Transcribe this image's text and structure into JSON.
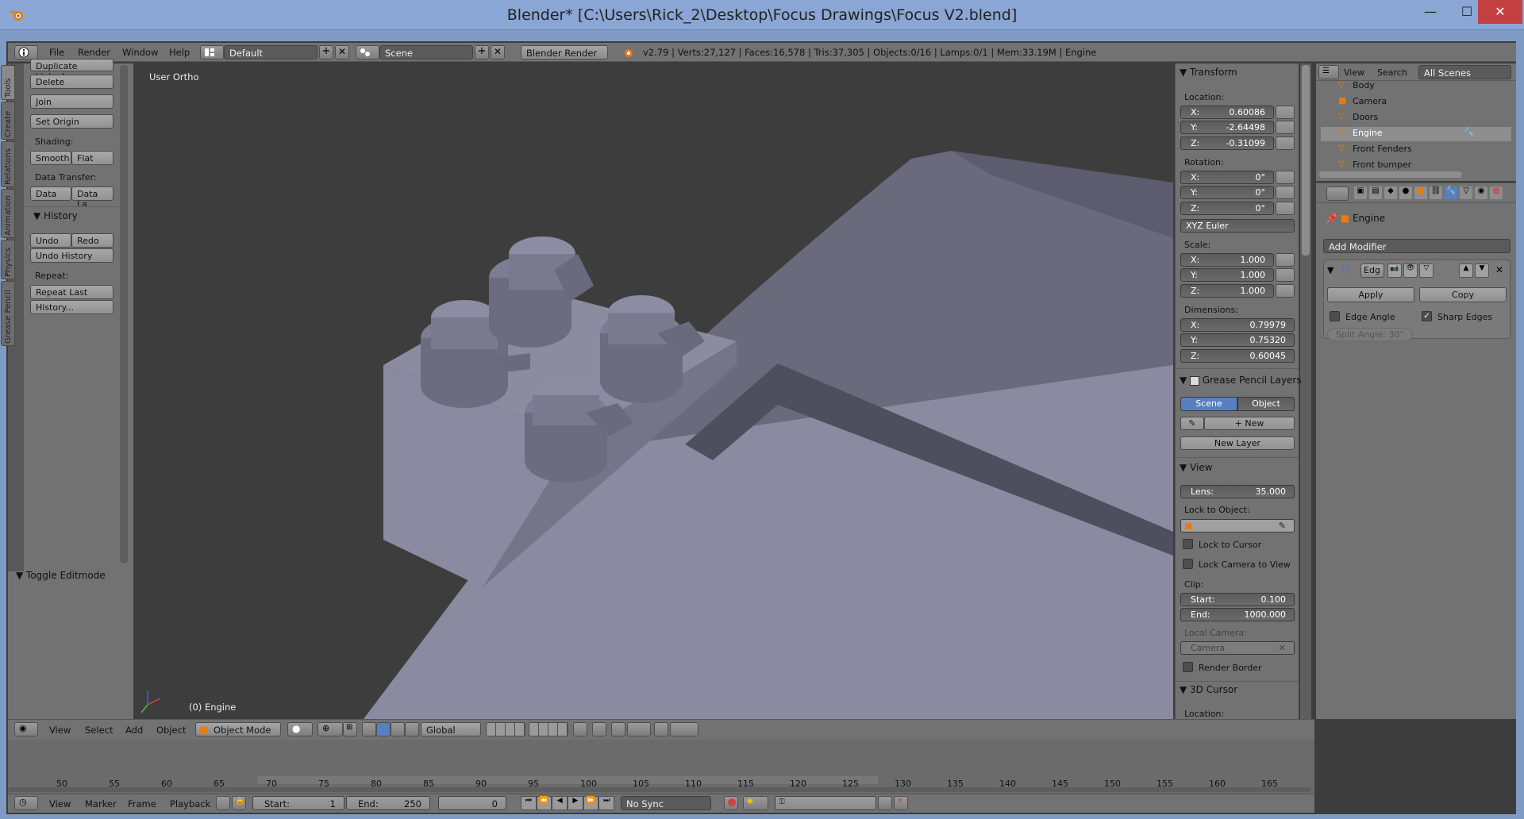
{
  "window": {
    "title": "Blender* [C:\\Users\\Rick_2\\Desktop\\Focus Drawings\\Focus V2.blend]",
    "minimize": "—",
    "maximize": "☐",
    "close": "✕"
  },
  "info_header": {
    "menus": [
      "File",
      "Render",
      "Window",
      "Help"
    ],
    "layout": "Default",
    "scene": "Scene",
    "engine": "Blender Render",
    "stats": "v2.79 | Verts:27,127 | Faces:16,578 | Tris:37,305 | Objects:0/16 | Lamps:0/1 | Mem:33.19M | Engine"
  },
  "tool_tabs": [
    "Tools",
    "Create",
    "Relations",
    "Animation",
    "Physics",
    "Grease Pencil"
  ],
  "tool_shelf": {
    "duplicate_linked": "Duplicate Linked",
    "delete": "Delete",
    "join": "Join",
    "set_origin": "Set Origin",
    "shading_label": "Shading:",
    "smooth": "Smooth",
    "flat": "Flat",
    "data_transfer_label": "Data Transfer:",
    "data": "Data",
    "data_layout": "Data La",
    "history_title": "History",
    "undo": "Undo",
    "redo": "Redo",
    "undo_history": "Undo History",
    "repeat_label": "Repeat:",
    "repeat_last": "Repeat Last",
    "history_btn": "History...",
    "toggle_editmode": "Toggle Editmode"
  },
  "viewport": {
    "view_label": "User Ortho",
    "object_label": "(0) Engine"
  },
  "npanel": {
    "transform_title": "Transform",
    "location_label": "Location:",
    "location": {
      "x": "0.60086",
      "y": "-2.64498",
      "z": "-0.31099"
    },
    "rotation_label": "Rotation:",
    "rotation": {
      "x": "0°",
      "y": "0°",
      "z": "0°"
    },
    "rotation_mode": "XYZ Euler",
    "scale_label": "Scale:",
    "scale": {
      "x": "1.000",
      "y": "1.000",
      "z": "1.000"
    },
    "dimensions_label": "Dimensions:",
    "dimensions": {
      "x": "0.79979",
      "y": "0.75320",
      "z": "0.60045"
    },
    "axis_x": "X:",
    "axis_y": "Y:",
    "axis_z": "Z:",
    "gp_title": "Grease Pencil Layers",
    "gp_scene": "Scene",
    "gp_object": "Object",
    "gp_new": "New",
    "gp_new_layer": "New Layer",
    "view_title": "View",
    "lens_label": "Lens:",
    "lens": "35.000",
    "lock_to_object": "Lock to Object:",
    "lock_to_cursor": "Lock to Cursor",
    "lock_camera": "Lock Camera to View",
    "clip_label": "Clip:",
    "clip_start_label": "Start:",
    "clip_start": "0.100",
    "clip_end_label": "End:",
    "clip_end": "1000.000",
    "local_camera": "Local Camera:",
    "camera": "Camera",
    "render_border": "Render Border",
    "cursor_title": "3D Cursor",
    "cursor_location": "Location:"
  },
  "outliner": {
    "view": "View",
    "search": "Search",
    "filter": "All Scenes",
    "items": [
      "Body",
      "Camera",
      "Doors",
      "Engine",
      "Front Fenders",
      "Front bumper"
    ],
    "selected_index": 3
  },
  "properties": {
    "object_name": "Engine",
    "add_modifier": "Add Modifier",
    "modifier_name": "Edg",
    "apply": "Apply",
    "copy": "Copy",
    "edge_angle": "Edge Angle",
    "sharp_edges": "Sharp Edges",
    "split_angle": "Split Angle: 30°"
  },
  "viewport_header": {
    "menus": [
      "View",
      "Select",
      "Add",
      "Object"
    ],
    "mode": "Object Mode",
    "orientation": "Global"
  },
  "timeline": {
    "numbers": [
      "50",
      "55",
      "60",
      "65",
      "70",
      "75",
      "80",
      "85",
      "90",
      "95",
      "100",
      "105",
      "110",
      "115",
      "120",
      "125",
      "130",
      "135",
      "140",
      "145",
      "150",
      "155",
      "160",
      "165"
    ],
    "menus": [
      "View",
      "Marker",
      "Frame",
      "Playback"
    ],
    "start_label": "Start:",
    "start": "1",
    "end_label": "End:",
    "end": "250",
    "current": "0",
    "sync": "No Sync"
  },
  "colors": {
    "accent_blue": "#5680c2",
    "panel_gray": "#727272",
    "viewport_bg": "#3d3d3d"
  }
}
